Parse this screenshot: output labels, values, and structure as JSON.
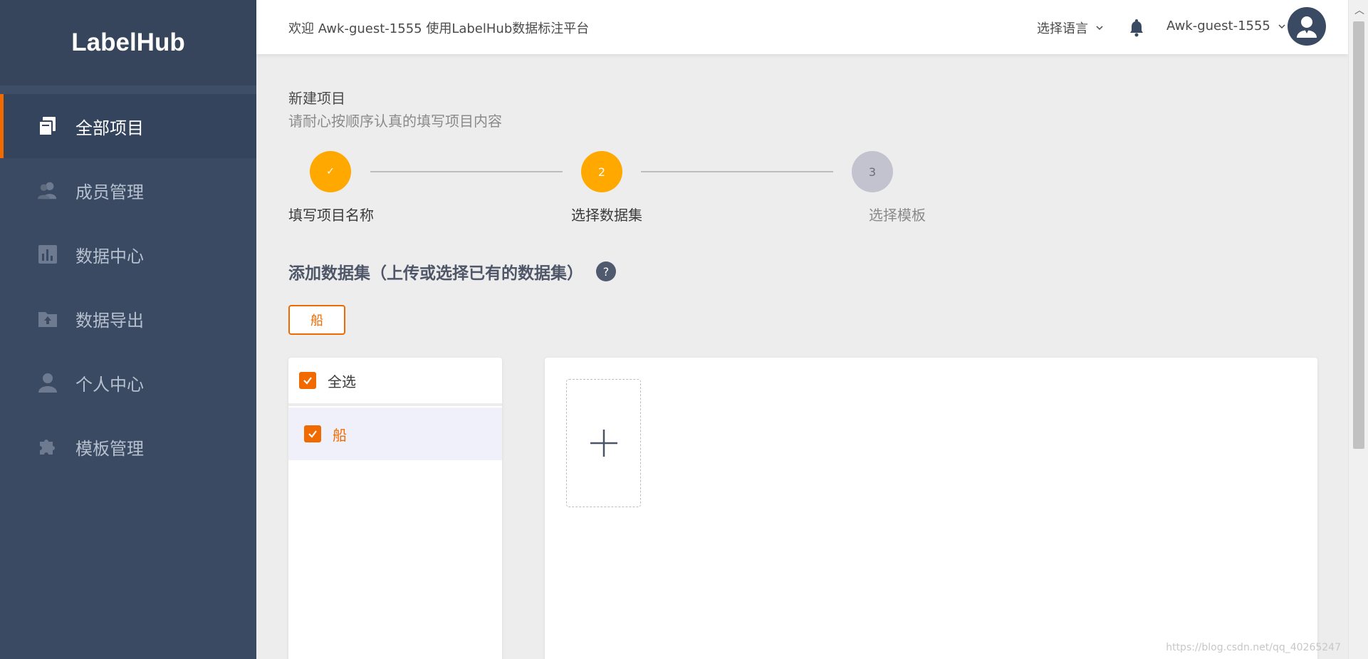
{
  "sidebar": {
    "brand": "LabelHub",
    "items": [
      {
        "label": "全部项目",
        "icon": "projects-icon",
        "active": true
      },
      {
        "label": "成员管理",
        "icon": "members-icon",
        "active": false
      },
      {
        "label": "数据中心",
        "icon": "data-center-icon",
        "active": false
      },
      {
        "label": "数据导出",
        "icon": "export-icon",
        "active": false
      },
      {
        "label": "个人中心",
        "icon": "user-icon",
        "active": false
      },
      {
        "label": "模板管理",
        "icon": "puzzle-icon",
        "active": false
      }
    ]
  },
  "header": {
    "welcome": "欢迎 Awk-guest-1555 使用LabelHub数据标注平台",
    "language": "选择语言",
    "username": "Awk-guest-1555"
  },
  "page": {
    "title": "新建项目",
    "subtitle": "请耐心按顺序认真的填写项目内容"
  },
  "steps": [
    {
      "number": "✓",
      "label": "填写项目名称",
      "state": "done"
    },
    {
      "number": "2",
      "label": "选择数据集",
      "state": "active"
    },
    {
      "number": "3",
      "label": "选择模板",
      "state": "pending"
    }
  ],
  "dataset": {
    "section_title": "添加数据集（上传或选择已有的数据集）",
    "help": "?",
    "tag": "船",
    "select_all": "全选",
    "items": [
      "船"
    ]
  },
  "watermark": "https://blog.csdn.net/qq_40265247",
  "colors": {
    "accent": "#f06a00",
    "step": "#ffa800",
    "step_pending": "#c2c3cf",
    "sidebar": "#3a4a62"
  }
}
